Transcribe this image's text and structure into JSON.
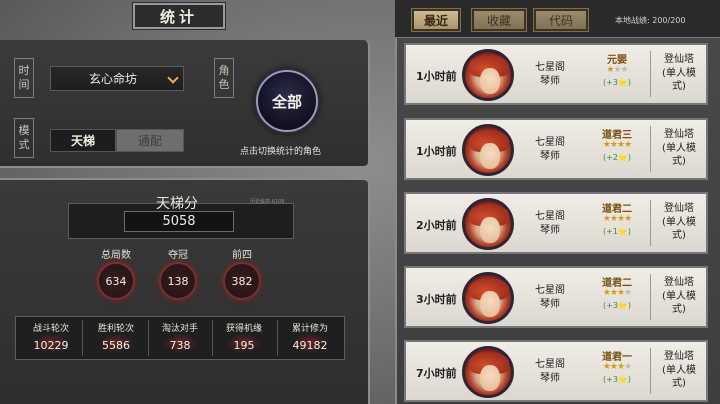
{
  "title": "统计",
  "filters": {
    "time_label": [
      "时",
      "间"
    ],
    "role_label": [
      "角",
      "色"
    ],
    "mode_label": [
      "模",
      "式"
    ],
    "faction": "玄心命坊",
    "modes": [
      "天梯",
      "通配"
    ],
    "all_button": "全部",
    "role_hint": "点击切换统计的角色"
  },
  "ladder": {
    "title": "天梯分",
    "score": "5058",
    "note": "历史最高:6108"
  },
  "summary": [
    {
      "label": "总局数",
      "value": "634"
    },
    {
      "label": "夺冠",
      "value": "138"
    },
    {
      "label": "前四",
      "value": "382"
    }
  ],
  "bottom_stats": [
    {
      "label": "战斗轮次",
      "value": "10229"
    },
    {
      "label": "胜利轮次",
      "value": "5586"
    },
    {
      "label": "淘汰对手",
      "value": "738"
    },
    {
      "label": "获得机缘",
      "value": "195"
    },
    {
      "label": "累计修为",
      "value": "49182"
    }
  ],
  "tabs": [
    "最近",
    "收藏",
    "代码"
  ],
  "local_records": "本地战绩: 200/200",
  "records": [
    {
      "time": "1小时前",
      "faction": "七星阁",
      "role": "琴师",
      "rank": "元婴",
      "stars_on": 1,
      "stars_total": 3,
      "delta": "(+3⭐)",
      "mode": [
        "登仙塔",
        "(单人模",
        "式)"
      ]
    },
    {
      "time": "1小时前",
      "faction": "七星阁",
      "role": "琴师",
      "rank": "道君三",
      "stars_on": 4,
      "stars_total": 4,
      "delta": "(+2⭐)",
      "mode": [
        "登仙塔",
        "(单人模",
        "式)"
      ]
    },
    {
      "time": "2小时前",
      "faction": "七星阁",
      "role": "琴师",
      "rank": "道君二",
      "stars_on": 4,
      "stars_total": 4,
      "delta": "(+1⭐)",
      "mode": [
        "登仙塔",
        "(单人模",
        "式)"
      ]
    },
    {
      "time": "3小时前",
      "faction": "七星阁",
      "role": "琴师",
      "rank": "道君二",
      "stars_on": 3,
      "stars_total": 4,
      "delta": "(+3⭐)",
      "mode": [
        "登仙塔",
        "(单人模",
        "式)"
      ]
    },
    {
      "time": "7小时前",
      "faction": "七星阁",
      "role": "琴师",
      "rank": "道君一",
      "stars_on": 3,
      "stars_total": 4,
      "delta": "(+3⭐)",
      "mode": [
        "登仙塔",
        "(单人模",
        "式)"
      ]
    }
  ],
  "colors": {
    "accent_gold": "#e5b64a",
    "card_bg": "#f0ede6",
    "delta_green": "#3e8c3e",
    "stat_ring_red": "#7a2e2e"
  }
}
